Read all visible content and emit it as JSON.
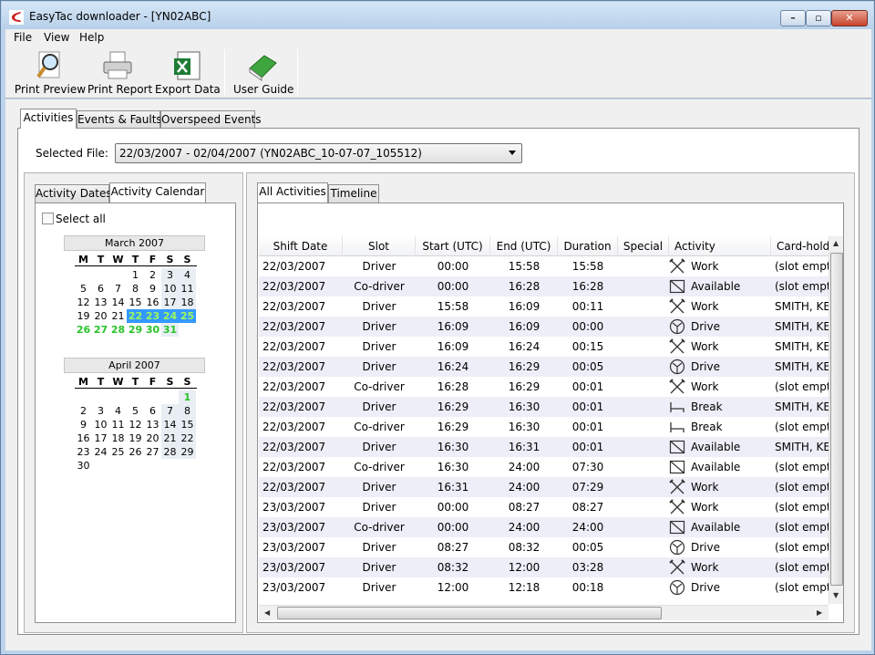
{
  "window": {
    "title": "EasyTac downloader - [YN02ABC]"
  },
  "menu": [
    "File",
    "View",
    "Help"
  ],
  "toolbar": {
    "print_preview": "Print Preview",
    "print_report": "Print Report",
    "export_data": "Export Data",
    "user_guide": "User Guide"
  },
  "main_tabs": [
    "Activities",
    "Events & Faults",
    "Overspeed Events"
  ],
  "selected_file": {
    "label": "Selected File:",
    "value": "22/03/2007 - 02/04/2007 (YN02ABC_10-07-07_105512)"
  },
  "left_tabs": [
    "Activity Dates",
    "Activity Calendar"
  ],
  "select_all": "Select all",
  "calendar": {
    "weekdays": [
      "M",
      "T",
      "W",
      "T",
      "F",
      "S",
      "S"
    ],
    "months": [
      {
        "title": "March 2007",
        "first_weekday": 3,
        "days": 31,
        "selected": [
          22,
          23,
          24,
          25
        ],
        "green": [
          26,
          27,
          28,
          29,
          30,
          31
        ]
      },
      {
        "title": "April 2007",
        "first_weekday": 6,
        "days": 30,
        "selected": [],
        "green": [
          1
        ]
      }
    ]
  },
  "right_tabs": [
    "All Activities",
    "Timeline"
  ],
  "grid": {
    "columns": [
      "Shift Date",
      "Slot",
      "Start (UTC)",
      "End (UTC)",
      "Duration",
      "Special",
      "Activity",
      "Card-hold"
    ],
    "rows": [
      [
        "22/03/2007",
        "Driver",
        "00:00",
        "15:58",
        "15:58",
        "",
        "Work",
        "(slot empty"
      ],
      [
        "22/03/2007",
        "Co-driver",
        "00:00",
        "16:28",
        "16:28",
        "",
        "Available",
        "(slot empty"
      ],
      [
        "22/03/2007",
        "Driver",
        "15:58",
        "16:09",
        "00:11",
        "",
        "Work",
        "SMITH, KEI"
      ],
      [
        "22/03/2007",
        "Driver",
        "16:09",
        "16:09",
        "00:00",
        "",
        "Drive",
        "SMITH, KEI"
      ],
      [
        "22/03/2007",
        "Driver",
        "16:09",
        "16:24",
        "00:15",
        "",
        "Work",
        "SMITH, KEI"
      ],
      [
        "22/03/2007",
        "Driver",
        "16:24",
        "16:29",
        "00:05",
        "",
        "Drive",
        "SMITH, KEI"
      ],
      [
        "22/03/2007",
        "Co-driver",
        "16:28",
        "16:29",
        "00:01",
        "",
        "Work",
        "(slot empty"
      ],
      [
        "22/03/2007",
        "Driver",
        "16:29",
        "16:30",
        "00:01",
        "",
        "Break",
        "SMITH, KEI"
      ],
      [
        "22/03/2007",
        "Co-driver",
        "16:29",
        "16:30",
        "00:01",
        "",
        "Break",
        "(slot empty"
      ],
      [
        "22/03/2007",
        "Driver",
        "16:30",
        "16:31",
        "00:01",
        "",
        "Available",
        "SMITH, KEI"
      ],
      [
        "22/03/2007",
        "Co-driver",
        "16:30",
        "24:00",
        "07:30",
        "",
        "Available",
        "(slot empty"
      ],
      [
        "22/03/2007",
        "Driver",
        "16:31",
        "24:00",
        "07:29",
        "",
        "Work",
        "(slot empty"
      ],
      [
        "23/03/2007",
        "Driver",
        "00:00",
        "08:27",
        "08:27",
        "",
        "Work",
        "(slot empty"
      ],
      [
        "23/03/2007",
        "Co-driver",
        "00:00",
        "24:00",
        "24:00",
        "",
        "Available",
        "(slot empty"
      ],
      [
        "23/03/2007",
        "Driver",
        "08:27",
        "08:32",
        "00:05",
        "",
        "Drive",
        "(slot empty"
      ],
      [
        "23/03/2007",
        "Driver",
        "08:32",
        "12:00",
        "03:28",
        "",
        "Work",
        "(slot empty"
      ],
      [
        "23/03/2007",
        "Driver",
        "12:00",
        "12:18",
        "00:18",
        "",
        "Drive",
        "(slot empty"
      ]
    ]
  },
  "icons": {
    "Work": "hammers-icon",
    "Available": "available-box-icon",
    "Drive": "steering-wheel-icon",
    "Break": "bed-icon"
  },
  "colors": {
    "selected_day": "#3399ff",
    "activity_day": "#28c428",
    "alt_row": "#eeeef8"
  }
}
